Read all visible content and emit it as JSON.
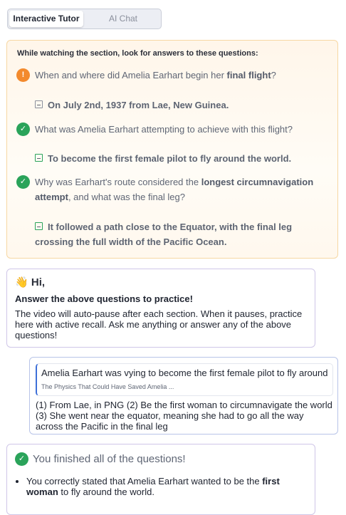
{
  "tabs": {
    "active": "Interactive Tutor",
    "inactive": "AI Chat"
  },
  "questions_panel": {
    "intro": "While watching the section, look for answers to these questions:",
    "questions": [
      {
        "status": "pending",
        "icon": "lightbulb-icon",
        "text_before": "When and where did Amelia Earhart begin her ",
        "bold": "final flight",
        "text_after": "?",
        "answer": "On July 2nd, 1937 from Lae, New Guinea."
      },
      {
        "status": "done",
        "icon": "check-icon",
        "text": "What was Amelia Earhart attempting to achieve with this flight?",
        "answer": "To become the first female pilot to fly around the world."
      },
      {
        "status": "done",
        "icon": "check-icon",
        "text_before": "Why was Earhart's route considered the ",
        "bold": "longest circumnavigation attempt",
        "text_after": ", and what was the final leg?",
        "answer": "It followed a path close to the Equator, with the final leg crossing the full width of the Pacific Ocean."
      }
    ]
  },
  "tutor_message": {
    "greeting_emoji": "👋",
    "greeting": "Hi,",
    "title": "Answer the above questions to practice!",
    "body": "The video will auto-pause after each section. When it pauses, practice here with active recall. Ask me anything or answer any of the above questions!"
  },
  "user_message": {
    "quote_text": "Amelia Earhart was vying to become the first female pilot to fly around the world",
    "quote_source": "The Physics That Could Have Saved Amelia ...",
    "body": "(1) From Lae, in PNG (2) Be the first woman to circumnavigate the world (3) She went near the equator, meaning she had to go all the way across the Pacific in the final leg"
  },
  "finished": {
    "title": "You finished all of the questions!",
    "bullets": [
      {
        "text_before": "You correctly stated that Amelia Earhart wanted to be the ",
        "bold": "first woman",
        "text_after": " to fly around the world."
      }
    ]
  },
  "colors": {
    "pending": "#f38a2d",
    "done": "#2aa35a",
    "panel_border": "#f7d7a3",
    "card_border": "#cfc6e8",
    "quote_accent": "#3d6fd8"
  }
}
